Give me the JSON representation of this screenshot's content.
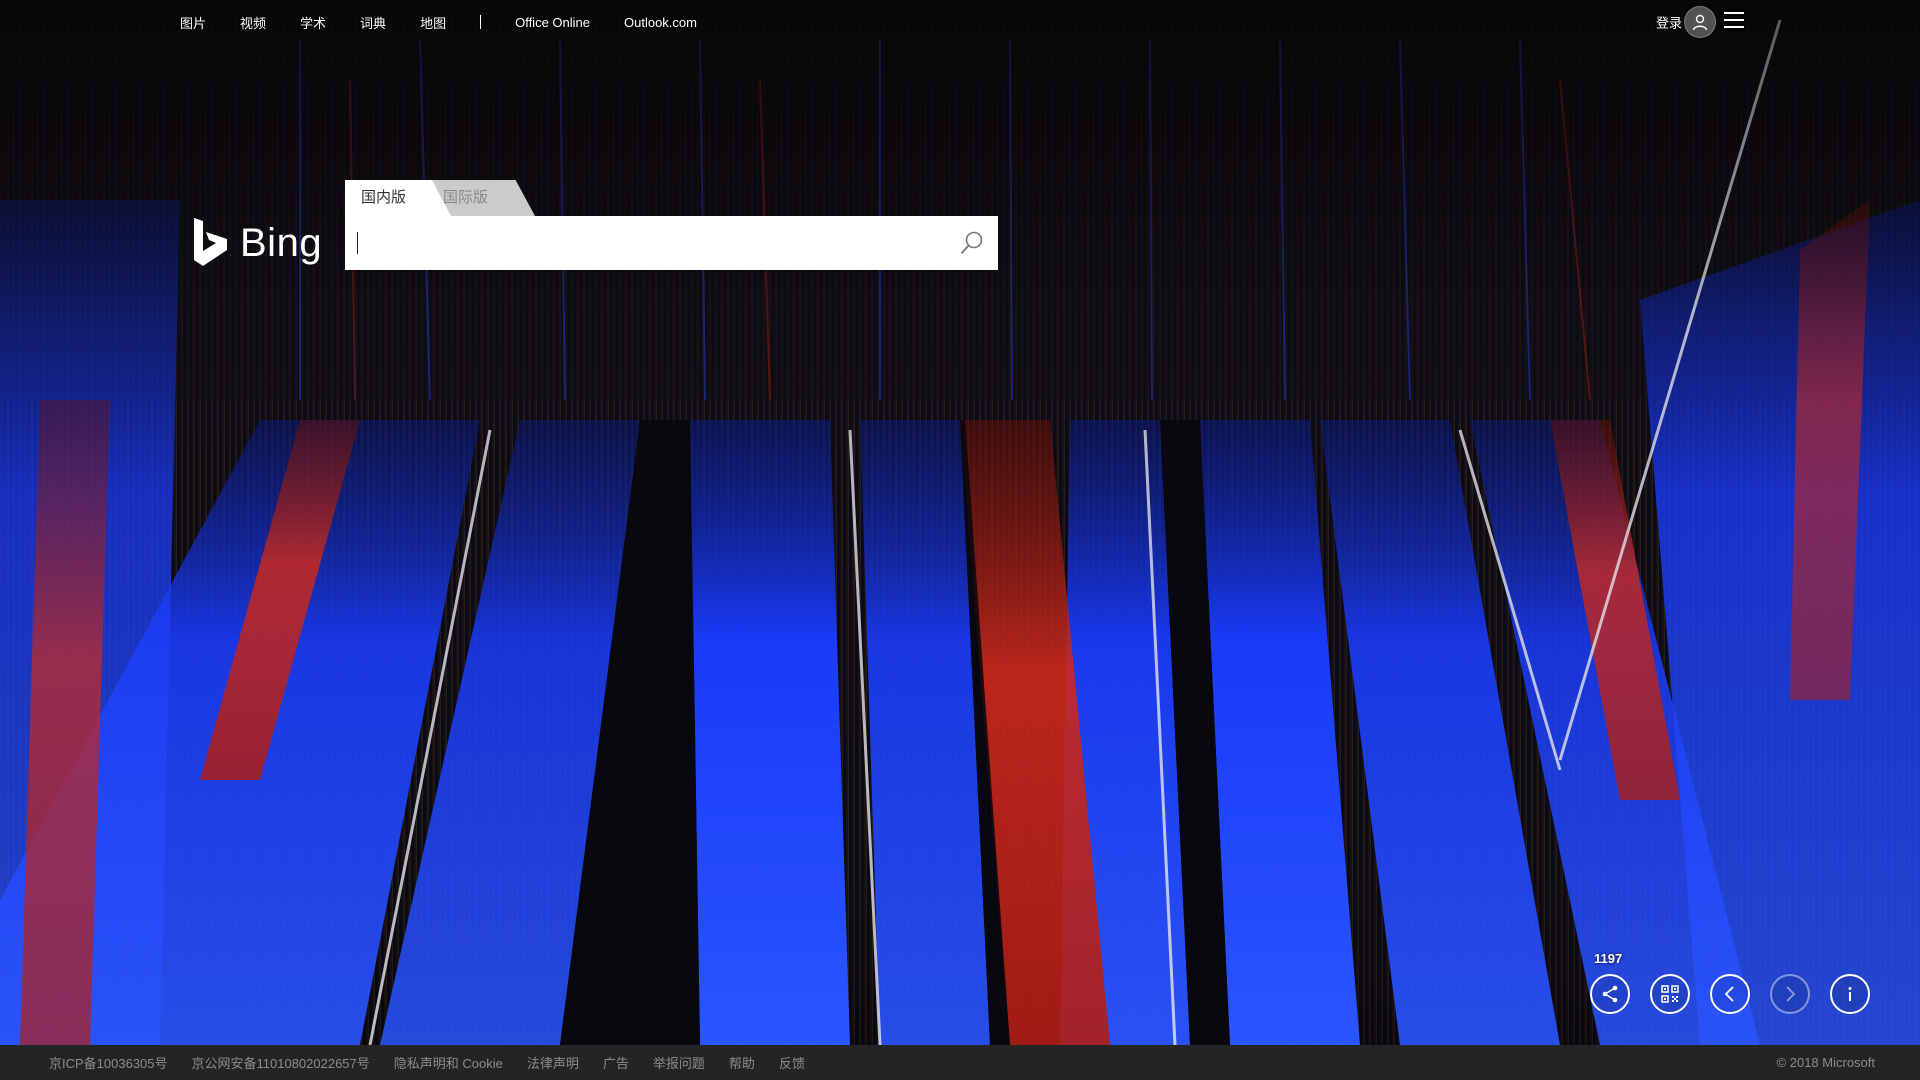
{
  "topnav": {
    "links": [
      {
        "label": "图片"
      },
      {
        "label": "视频"
      },
      {
        "label": "学术"
      },
      {
        "label": "词典"
      },
      {
        "label": "地图"
      }
    ],
    "separator": "|",
    "external_links": [
      {
        "label": "Office Online"
      },
      {
        "label": "Outlook.com"
      }
    ],
    "login_label": "登录",
    "avatar_icon": "user-icon",
    "menu_icon": "hamburger-menu-icon"
  },
  "logo": {
    "text": "Bing",
    "icon": "bing-b-icon"
  },
  "search": {
    "tabs": [
      {
        "label": "国内版",
        "active": true
      },
      {
        "label": "国际版",
        "active": false
      }
    ],
    "value": "",
    "button_icon": "search-icon"
  },
  "image_controls": {
    "count": "1197",
    "buttons": [
      {
        "icon": "share-icon"
      },
      {
        "icon": "qr-code-icon"
      },
      {
        "icon": "chevron-left-icon"
      },
      {
        "icon": "chevron-right-icon",
        "disabled": true
      },
      {
        "icon": "info-icon"
      }
    ]
  },
  "footer": {
    "links": [
      {
        "label": "京ICP备10036305号"
      },
      {
        "label": "京公网安备11010802022657号"
      },
      {
        "label": "隐私声明和 Cookie"
      },
      {
        "label": "法律声明"
      },
      {
        "label": "广告"
      },
      {
        "label": "举报问题"
      },
      {
        "label": "帮助"
      },
      {
        "label": "反馈"
      }
    ],
    "copyright": "© 2018 Microsoft"
  },
  "colors": {
    "thread_blue": "#1a3cff",
    "thread_red": "#d22a1e",
    "footer_bg": "#282828",
    "footer_text": "#8c8c8c"
  }
}
